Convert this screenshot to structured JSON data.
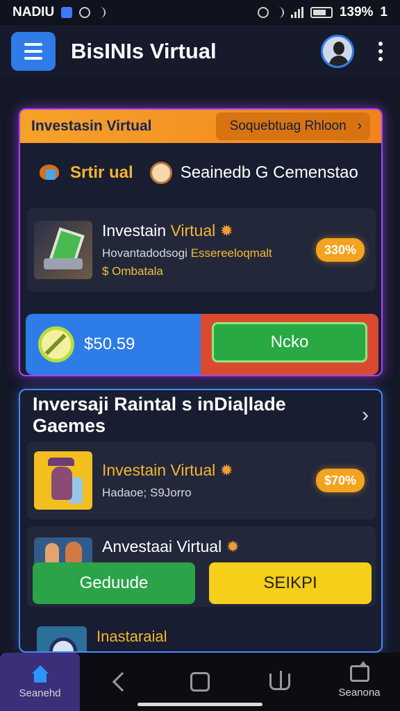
{
  "status_bar": {
    "left_text": "NADIU",
    "right_text": "139%",
    "right_suffix": "1"
  },
  "header": {
    "title": "BisINIs Virtual"
  },
  "panel1": {
    "top_title": "Investasin Virtual",
    "top_button": "Soquebtuag Rhloon",
    "section_a": "Srtir ual",
    "section_b": "Seainedb G Cemenstao",
    "card": {
      "title": "Investain",
      "title_accent": "Virtual",
      "subtitle_a": "Hovantadodsogi",
      "subtitle_b": "Essereeloqmalt",
      "line3": "$ Ombatala",
      "percent": "330%"
    },
    "amount": "$50.59",
    "green_button": "Ncko"
  },
  "panel2": {
    "title": "Inversaji Raintal s inDia|lade Gaemes",
    "card1": {
      "title": "Investain Virtual",
      "subtitle": "Hadaoe; S9Jorro",
      "percent": "$70%"
    },
    "card2": {
      "title": "Anvestaai Virtual"
    },
    "buttons": {
      "green": "Geduude",
      "yellow": "SEIKPI"
    },
    "card3": {
      "title": "Inastaraial"
    }
  },
  "bottom_nav": {
    "left_label": "Seanehd",
    "right_label": "Seanona"
  }
}
